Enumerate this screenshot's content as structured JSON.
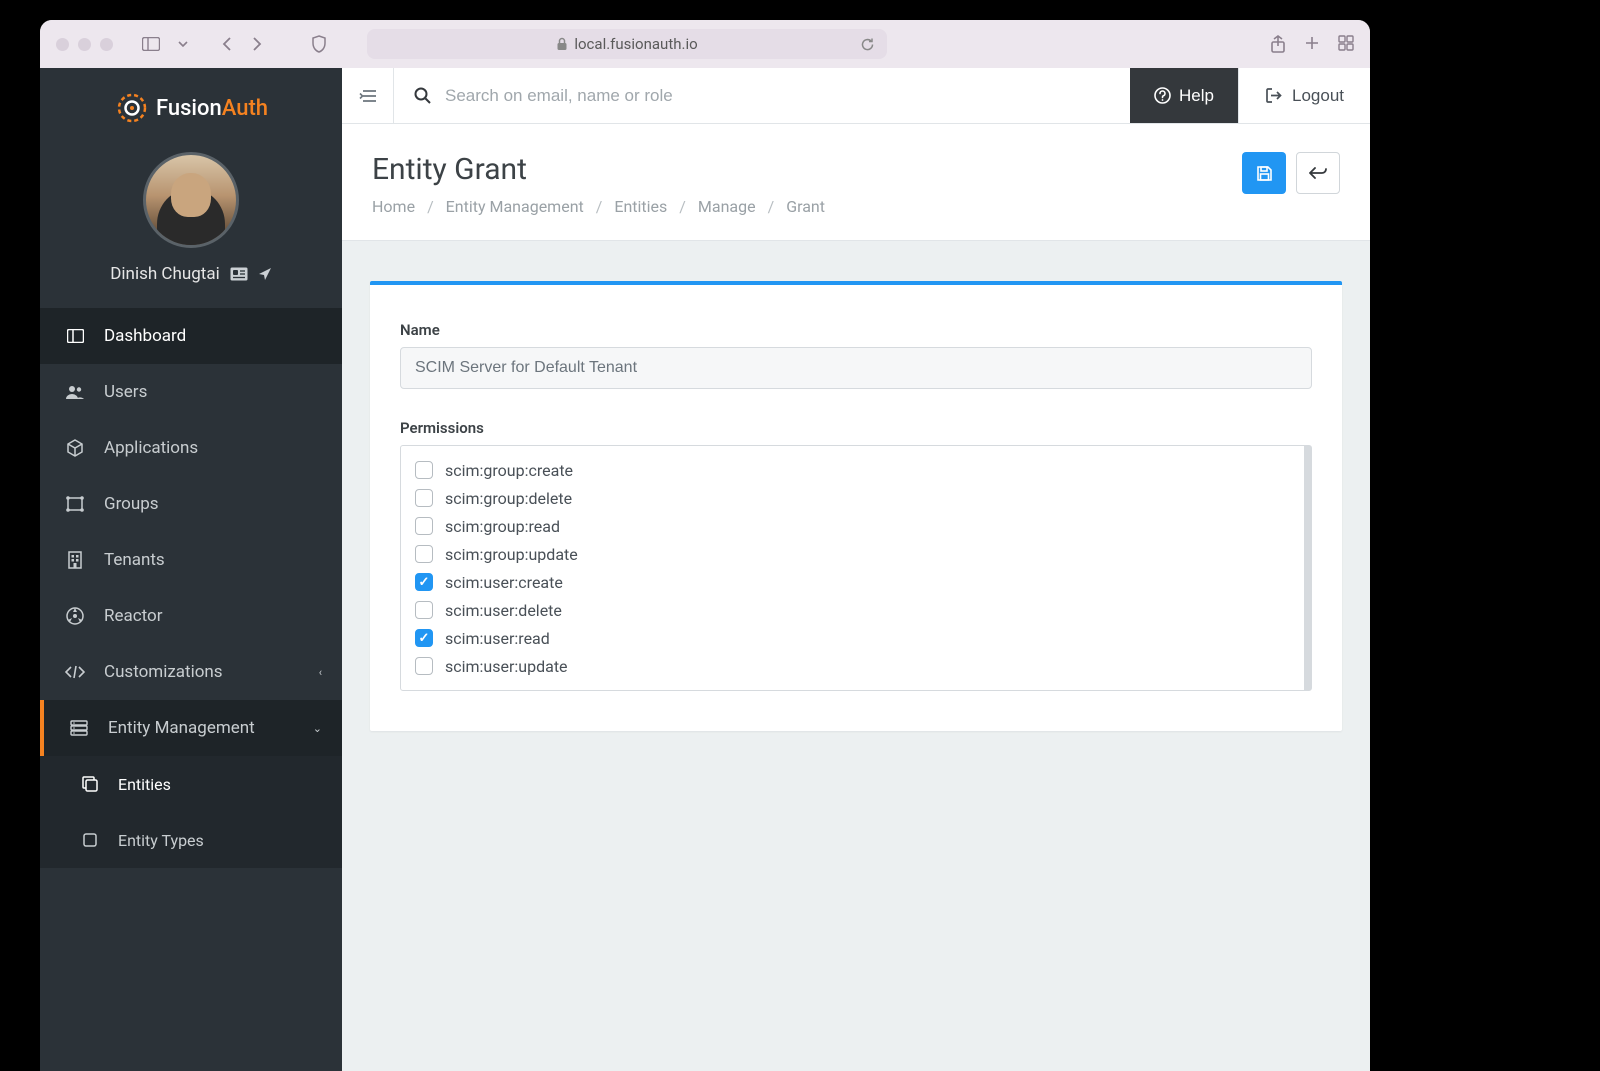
{
  "browser": {
    "url": "local.fusionauth.io"
  },
  "brand": {
    "name_a": "Fusion",
    "name_b": "Auth"
  },
  "user": {
    "name": "Dinish Chugtai"
  },
  "sidebar": {
    "items": [
      {
        "label": "Dashboard"
      },
      {
        "label": "Users"
      },
      {
        "label": "Applications"
      },
      {
        "label": "Groups"
      },
      {
        "label": "Tenants"
      },
      {
        "label": "Reactor"
      },
      {
        "label": "Customizations"
      },
      {
        "label": "Entity Management"
      },
      {
        "label": "Entities"
      },
      {
        "label": "Entity Types"
      }
    ]
  },
  "topbar": {
    "search_placeholder": "Search on email, name or role",
    "help": "Help",
    "logout": "Logout"
  },
  "page": {
    "title": "Entity Grant",
    "crumbs": [
      "Home",
      "Entity Management",
      "Entities",
      "Manage",
      "Grant"
    ]
  },
  "form": {
    "name_label": "Name",
    "name_value": "SCIM Server for Default Tenant",
    "perms_label": "Permissions",
    "permissions": [
      {
        "label": "scim:group:create",
        "checked": false
      },
      {
        "label": "scim:group:delete",
        "checked": false
      },
      {
        "label": "scim:group:read",
        "checked": false
      },
      {
        "label": "scim:group:update",
        "checked": false
      },
      {
        "label": "scim:user:create",
        "checked": true
      },
      {
        "label": "scim:user:delete",
        "checked": false
      },
      {
        "label": "scim:user:read",
        "checked": true
      },
      {
        "label": "scim:user:update",
        "checked": false
      }
    ]
  }
}
